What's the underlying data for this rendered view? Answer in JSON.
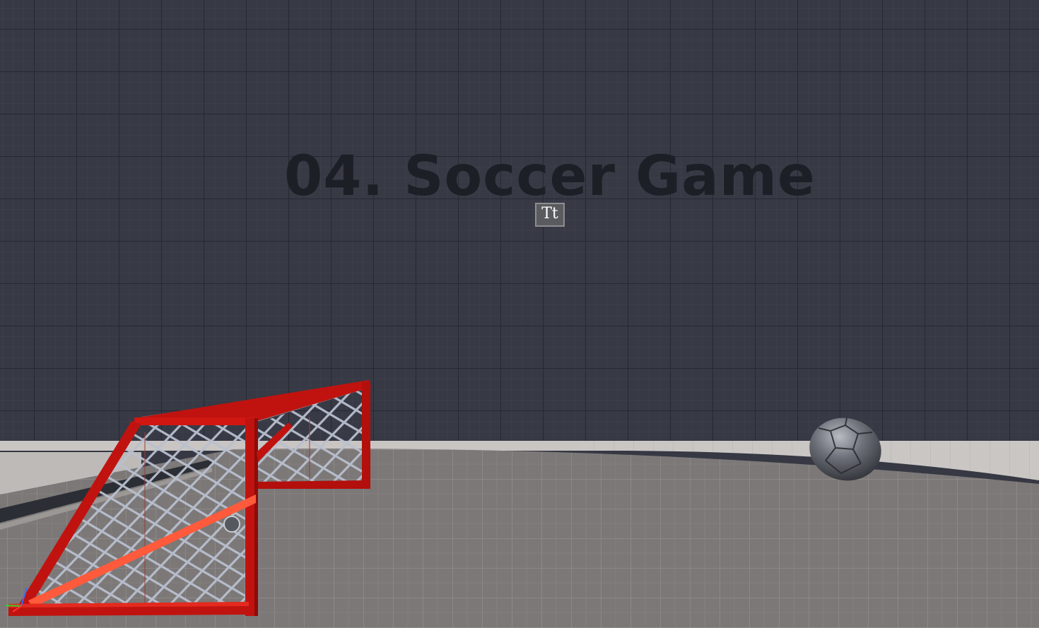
{
  "scene": {
    "title": "04. Soccer Game",
    "text_actor_icon": "Tt",
    "icons": {
      "text_actor": "text-render-actor-icon",
      "gizmo": "axis-gizmo-icon"
    },
    "colors": {
      "wall": "#373945",
      "floor": "#7b7877",
      "goal_frame": "#c0130f",
      "goal_net": "#b6bdcc",
      "ball": "#5d6068"
    }
  }
}
